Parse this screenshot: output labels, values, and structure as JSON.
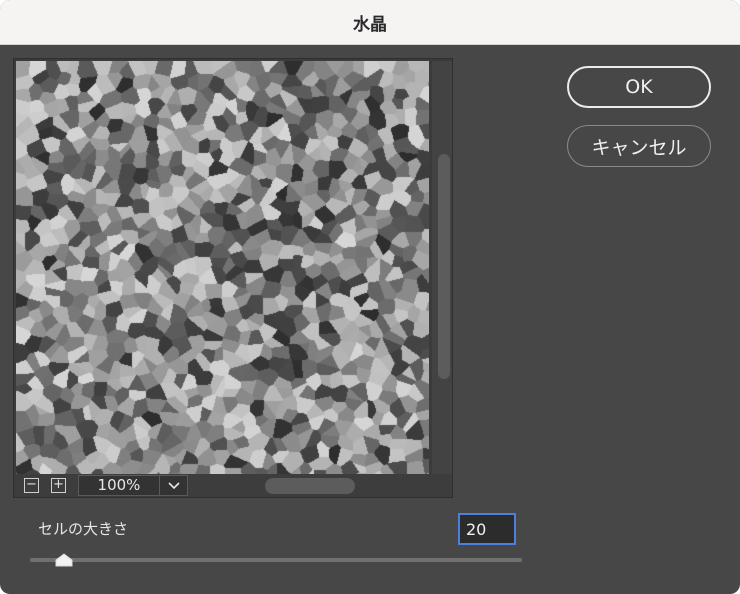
{
  "dialog": {
    "title": "水晶"
  },
  "preview": {
    "zoom_out_icon": "minus-square-icon",
    "zoom_in_icon": "plus-square-icon",
    "zoom_value": "100%",
    "zoom_dropdown_icon": "chevron-down-icon"
  },
  "buttons": {
    "ok_label": "OK",
    "cancel_label": "キャンセル"
  },
  "parameter": {
    "label": "セルの大きさ",
    "value": "20",
    "slider_fraction": 0.07
  },
  "colors": {
    "accent": "#4d7fe0",
    "dialog_bg": "#474747",
    "titlebar_bg": "#f6f3f3"
  }
}
